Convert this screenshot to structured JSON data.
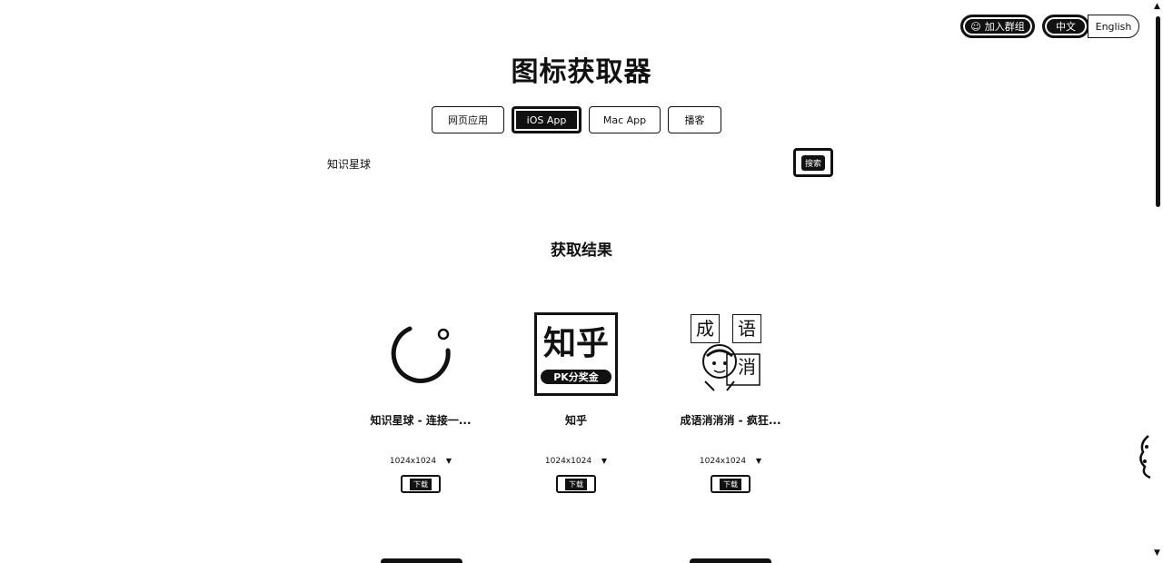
{
  "header": {
    "join_group": "加入群组",
    "lang_zh": "中文",
    "lang_en": "English"
  },
  "title": "图标获取器",
  "tabs": [
    {
      "label": "网页应用"
    },
    {
      "label": "iOS App"
    },
    {
      "label": "Mac App"
    },
    {
      "label": "播客"
    }
  ],
  "search": {
    "value": "知识星球",
    "button": "搜索"
  },
  "results": {
    "title": "获取结果",
    "items": [
      {
        "name": "知识星球 - 连接一...",
        "size": "1024x1024",
        "download": "下载",
        "icon": "knowledge-planet-icon"
      },
      {
        "name": "知乎",
        "size": "1024x1024",
        "download": "下载",
        "icon": "zhihu-icon"
      },
      {
        "name": "成语消消消 - 疯狂...",
        "size": "1024x1024",
        "download": "下载",
        "icon": "idiom-game-icon"
      }
    ]
  },
  "zhihu_icon_text": {
    "main": "知乎",
    "sub": "PK分奖金"
  },
  "idiom_icon_text": {
    "c1": "成",
    "c2": "语",
    "c3": "消"
  }
}
